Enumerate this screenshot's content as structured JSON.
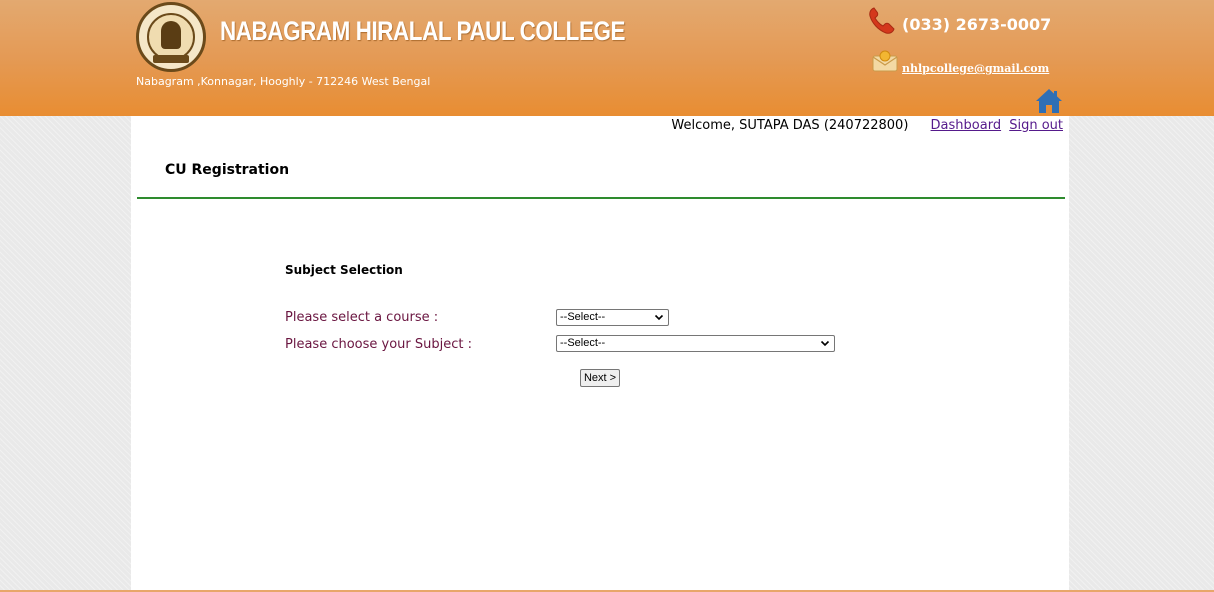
{
  "header": {
    "college_name": "NABAGRAM HIRALAL PAUL COLLEGE",
    "address": "Nabagram ,Konnagar, Hooghly - 712246 West Bengal",
    "phone": "(033) 2673-0007",
    "email": "nhlpcollege@gmail.com",
    "icons": {
      "logo": "college-seal-logo",
      "phone": "phone-icon",
      "email": "mail-icon",
      "home": "home-icon"
    },
    "colors": {
      "banner_top": "#e3a970",
      "banner_bottom": "#e88d32",
      "home_icon": "#2f6fb5"
    }
  },
  "userbar": {
    "welcome": "Welcome, SUTAPA DAS (240722800)",
    "dashboard_label": "Dashboard",
    "signout_label": "Sign out"
  },
  "page": {
    "title": "CU Registration",
    "divider_color": "#2e8b2e"
  },
  "form": {
    "section_title": "Subject Selection",
    "course_label": "Please select a course :",
    "course_value": "--Select--",
    "subject_label": "Please choose your Subject :",
    "subject_value": "--Select--",
    "next_label": "Next >",
    "label_color": "#6a1540"
  }
}
